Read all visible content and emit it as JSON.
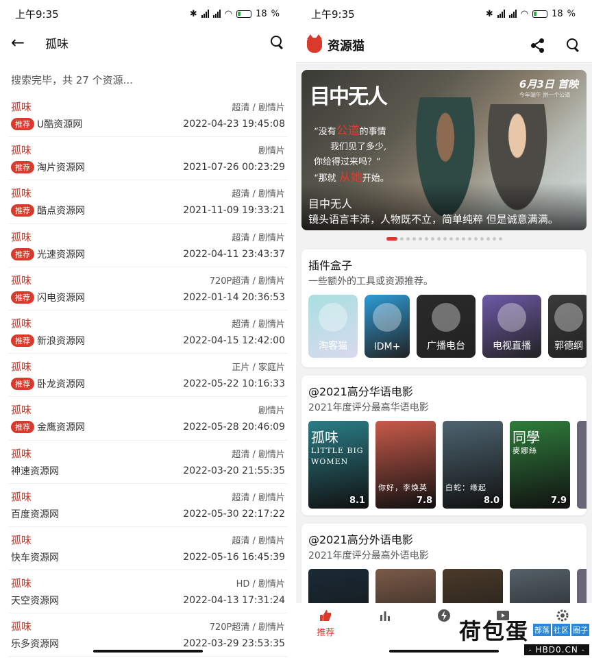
{
  "status": {
    "time": "上午9:35",
    "battery": "18"
  },
  "left": {
    "title": "孤味",
    "summary": "搜索完毕，共 27 个资源...",
    "results": [
      {
        "name": "孤味",
        "meta": "超清 / 剧情片",
        "badge": "推荐",
        "source": "U酷资源网",
        "date": "2022-04-23 19:45:08"
      },
      {
        "name": "孤味",
        "meta": "剧情片",
        "badge": "推荐",
        "source": "淘片资源网",
        "date": "2021-07-26 00:23:29"
      },
      {
        "name": "孤味",
        "meta": "超清 / 剧情片",
        "badge": "推荐",
        "source": "酷点资源网",
        "date": "2021-11-09 19:33:21"
      },
      {
        "name": "孤味",
        "meta": "超清 / 剧情片",
        "badge": "推荐",
        "source": "光速资源网",
        "date": "2022-04-11 23:43:37"
      },
      {
        "name": "孤味",
        "meta": "720P超清 / 剧情片",
        "badge": "推荐",
        "source": "闪电资源网",
        "date": "2022-01-14 20:36:53"
      },
      {
        "name": "孤味",
        "meta": "超清 / 剧情片",
        "badge": "推荐",
        "source": "新浪资源网",
        "date": "2022-04-15 12:42:00"
      },
      {
        "name": "孤味",
        "meta": "正片 / 家庭片",
        "badge": "推荐",
        "source": "卧龙资源网",
        "date": "2022-05-22 10:16:33"
      },
      {
        "name": "孤味",
        "meta": "剧情片",
        "badge": "推荐",
        "source": "金鹰资源网",
        "date": "2022-05-28 20:46:09"
      },
      {
        "name": "孤味",
        "meta": "超清 / 剧情片",
        "badge": "",
        "source": "神速资源网",
        "date": "2022-03-20 21:55:35"
      },
      {
        "name": "孤味",
        "meta": "超清 / 剧情片",
        "badge": "",
        "source": "百度资源网",
        "date": "2022-05-30 22:17:22"
      },
      {
        "name": "孤味",
        "meta": "超清 / 剧情片",
        "badge": "",
        "source": "快车资源网",
        "date": "2022-05-16 16:45:39"
      },
      {
        "name": "孤味",
        "meta": "HD / 剧情片",
        "badge": "",
        "source": "天空资源网",
        "date": "2022-04-13 17:31:24"
      },
      {
        "name": "孤味",
        "meta": "720P超清 / 剧情片",
        "badge": "",
        "source": "乐多资源网",
        "date": "2022-03-29 23:53:35"
      }
    ]
  },
  "right": {
    "app_title": "资源猫",
    "banner": {
      "poster_title": "目中无人",
      "release": "6月3日 首映",
      "release_small": "今年端午 拼一个公道",
      "quote_lines": [
        "“没有",
        "公道",
        "的事情",
        "我们见了多少,",
        "你给得过来吗？”",
        "“那就",
        "从她",
        "开始。"
      ],
      "caption_title": "目中无人",
      "caption_sub": "镜头语言丰沛，人物既不立，简单纯粹 但是诚意满满。"
    },
    "plugins": {
      "title": "插件盒子",
      "subtitle": "一些额外的工具或资源推荐。",
      "items": [
        {
          "label": "淘客猫",
          "color": "#a8e0e0"
        },
        {
          "label": "IDM+",
          "color": "#2e9bd6"
        },
        {
          "label": "广播电台",
          "color": "#2a2a2a"
        },
        {
          "label": "电视直播",
          "color": "#6e5aa8"
        },
        {
          "label": "郭德纲",
          "color": "#3a3a3a"
        }
      ]
    },
    "section_cn": {
      "title": "@2021高分华语电影",
      "subtitle": "2021年度评分最高华语电影",
      "movies": [
        {
          "title": "孤味",
          "sub": "LITTLE BIG WOMEN",
          "score": "8.1",
          "color": "#2a7d86"
        },
        {
          "title": "",
          "sub": "你好，李焕英",
          "score": "7.8",
          "color": "#c85a4a"
        },
        {
          "title": "",
          "sub": "白蛇：缘起",
          "score": "8.0",
          "color": "#4d6470"
        },
        {
          "title": "同學",
          "sub": "麥娜絲",
          "score": "7.9",
          "color": "#2e7d3b"
        }
      ]
    },
    "section_foreign": {
      "title": "@2021高分外语电影",
      "subtitle": "2021年度评分最高外语电影",
      "movies": [
        {
          "color": "#1b2a35"
        },
        {
          "color": "#7a5a48"
        },
        {
          "color": "#4a3a2a"
        },
        {
          "color": "#556068"
        }
      ]
    },
    "tabs": [
      {
        "label": "推荐",
        "active": true
      }
    ]
  },
  "watermark": {
    "brand": "荷包蛋",
    "tags": [
      "部落",
      "社区",
      "圈子"
    ],
    "url": "- HBD0.CN -"
  }
}
